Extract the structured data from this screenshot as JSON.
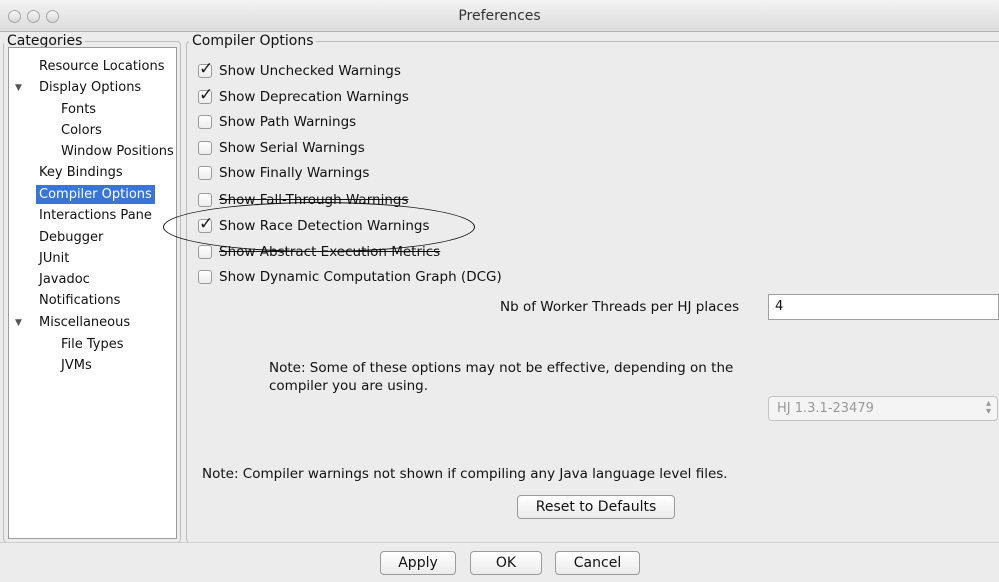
{
  "window": {
    "title": "Preferences"
  },
  "categories": {
    "label": "Categories",
    "items": [
      {
        "label": "Resource Locations",
        "level": 0,
        "selected": false
      },
      {
        "label": "Display Options",
        "level": 0,
        "expanded": true,
        "selected": false
      },
      {
        "label": "Fonts",
        "level": 1,
        "selected": false
      },
      {
        "label": "Colors",
        "level": 1,
        "selected": false
      },
      {
        "label": "Window Positions",
        "level": 1,
        "selected": false
      },
      {
        "label": "Key Bindings",
        "level": 0,
        "selected": false
      },
      {
        "label": "Compiler Options",
        "level": 0,
        "selected": true
      },
      {
        "label": "Interactions Pane",
        "level": 0,
        "selected": false
      },
      {
        "label": "Debugger",
        "level": 0,
        "selected": false
      },
      {
        "label": "JUnit",
        "level": 0,
        "selected": false
      },
      {
        "label": "Javadoc",
        "level": 0,
        "selected": false
      },
      {
        "label": "Notifications",
        "level": 0,
        "selected": false
      },
      {
        "label": "Miscellaneous",
        "level": 0,
        "expanded": true,
        "selected": false
      },
      {
        "label": "File Types",
        "level": 1,
        "selected": false
      },
      {
        "label": "JVMs",
        "level": 1,
        "selected": false
      }
    ]
  },
  "compiler": {
    "label": "Compiler Options",
    "checkboxes": [
      {
        "label": "Show Unchecked Warnings",
        "checked": true
      },
      {
        "label": "Show Deprecation Warnings",
        "checked": true
      },
      {
        "label": "Show Path Warnings",
        "checked": false
      },
      {
        "label": "Show Serial Warnings",
        "checked": false
      },
      {
        "label": "Show Finally Warnings",
        "checked": false
      },
      {
        "label": "Show Fall-Through Warnings",
        "checked": false
      },
      {
        "label": "Show Race Detection Warnings",
        "checked": true
      },
      {
        "label": "Show Abstract Execution Metrics",
        "checked": false
      },
      {
        "label": "Show Dynamic Computation Graph (DCG)",
        "checked": false
      }
    ],
    "worker_threads_label": "Nb of Worker Threads per HJ places",
    "worker_threads_value": "4",
    "note_line1": "Note: Some of these options may not be effective, depending on the",
    "note_line2": "compiler you are using.",
    "compiler_select_value": "HJ 1.3.1-23479",
    "warnings_note": "Note: Compiler warnings not shown if compiling any Java language level files.",
    "reset_button": "Reset to Defaults"
  },
  "buttons": {
    "apply": "Apply",
    "ok": "OK",
    "cancel": "Cancel"
  }
}
